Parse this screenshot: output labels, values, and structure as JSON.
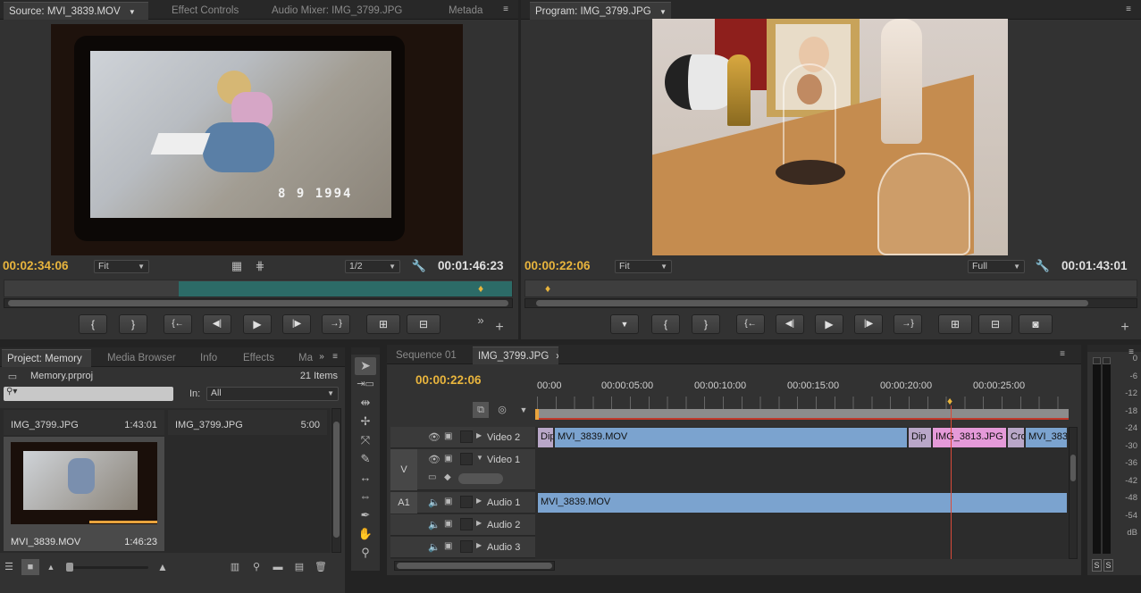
{
  "source": {
    "tabs": [
      {
        "label": "Source: MVI_3839.MOV",
        "active": true
      },
      {
        "label": "Effect Controls",
        "active": false
      },
      {
        "label": "Audio Mixer: IMG_3799.JPG",
        "active": false
      },
      {
        "label": "Metada",
        "active": false
      }
    ],
    "timecode_current": "00:02:34:06",
    "timecode_duration": "00:01:46:23",
    "zoom": "Fit",
    "resolution": "1/2",
    "video_date_overlay": "8 9 1994"
  },
  "program": {
    "tab": "Program: IMG_3799.JPG",
    "timecode_current": "00:00:22:06",
    "timecode_duration": "00:01:43:01",
    "zoom": "Fit",
    "resolution": "Full"
  },
  "transport_glyphs": {
    "marker": "▼",
    "mark_in": "{",
    "mark_out": "}",
    "go_in": "{←",
    "step_back": "◀|",
    "play": "▶",
    "step_fwd": "|▶",
    "go_out": "→}",
    "insert": "⊞",
    "overwrite": "⊟",
    "export_frame": "📷",
    "add": "+",
    "more": "»"
  },
  "project": {
    "tabs": [
      {
        "label": "Project: Memory",
        "active": true
      },
      {
        "label": "Media Browser",
        "active": false
      },
      {
        "label": "Info",
        "active": false
      },
      {
        "label": "Effects",
        "active": false
      },
      {
        "label": "Ma",
        "active": false
      }
    ],
    "file": "Memory.prproj",
    "item_count": "21 Items",
    "search_placeholder": "",
    "in_label": "In:",
    "in_value": "All",
    "items": [
      {
        "name": "IMG_3799.JPG",
        "duration": "1:43:01"
      },
      {
        "name": "IMG_3799.JPG",
        "duration": "5:00"
      },
      {
        "name": "MVI_3839.MOV",
        "duration": "1:46:23"
      }
    ]
  },
  "timeline": {
    "tabs": [
      {
        "label": "Sequence 01",
        "active": false
      },
      {
        "label": "IMG_3799.JPG",
        "active": true
      }
    ],
    "timecode": "00:00:22:06",
    "ruler_labels": [
      "00:00",
      "00:00:05:00",
      "00:00:10:00",
      "00:00:15:00",
      "00:00:20:00",
      "00:00:25:00"
    ],
    "playhead_seconds": 22.2,
    "tracks": {
      "video2": "Video 2",
      "video1": "Video 1",
      "v_label": "V",
      "a1_label": "A1",
      "audio1": "Audio 1",
      "audio2": "Audio 2",
      "audio3": "Audio 3"
    },
    "video2_clips": [
      {
        "label": "Dip",
        "kind": "tr"
      },
      {
        "label": "MVI_3839.MOV",
        "kind": "blue"
      },
      {
        "label": "Dip",
        "kind": "tr"
      },
      {
        "label": "IMG_3813.JPG",
        "kind": "pink"
      },
      {
        "label": "Cro",
        "kind": "tr"
      },
      {
        "label": "MVI_383",
        "kind": "blue"
      }
    ],
    "audio1_clip": "MVI_3839.MOV"
  },
  "meter": {
    "labels": [
      "0",
      "-6",
      "-12",
      "-18",
      "-24",
      "-30",
      "-36",
      "-42",
      "-48",
      "-54",
      "dB"
    ],
    "solo": [
      "S",
      "S"
    ]
  },
  "colors": {
    "timecode": "#e9b53d",
    "clip_blue": "#7ba3cf",
    "clip_pink": "#e59ad9",
    "playhead": "#d94a3a"
  }
}
